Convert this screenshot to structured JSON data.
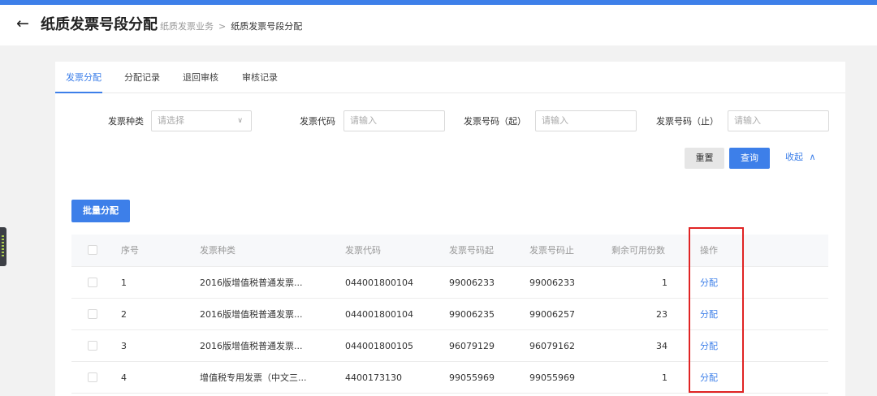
{
  "header": {
    "title": "纸质发票号段分配",
    "breadcrumb": [
      "纸质发票业务",
      "纸质发票号段分配"
    ],
    "breadcrumb_sep": ">"
  },
  "tabs": [
    {
      "label": "发票分配",
      "active": true
    },
    {
      "label": "分配记录",
      "active": false
    },
    {
      "label": "退回审核",
      "active": false
    },
    {
      "label": "审核记录",
      "active": false
    }
  ],
  "filters": {
    "type_label": "发票种类",
    "type_placeholder": "请选择",
    "code_label": "发票代码",
    "code_placeholder": "请输入",
    "start_label": "发票号码（起）",
    "start_placeholder": "请输入",
    "end_label": "发票号码（止）",
    "end_placeholder": "请输入"
  },
  "actions": {
    "reset": "重置",
    "query": "查询",
    "collapse": "收起",
    "batch": "批量分配"
  },
  "table": {
    "columns": [
      "序号",
      "发票种类",
      "发票代码",
      "发票号码起",
      "发票号码止",
      "剩余可用份数",
      "操作"
    ],
    "rows": [
      {
        "index": "1",
        "type": "2016版增值税普通发票...",
        "code": "044001800104",
        "start": "99006233",
        "end": "99006233",
        "remaining": "1",
        "op": "分配"
      },
      {
        "index": "2",
        "type": "2016版增值税普通发票...",
        "code": "044001800104",
        "start": "99006235",
        "end": "99006257",
        "remaining": "23",
        "op": "分配"
      },
      {
        "index": "3",
        "type": "2016版增值税普通发票...",
        "code": "044001800105",
        "start": "96079129",
        "end": "96079162",
        "remaining": "34",
        "op": "分配"
      },
      {
        "index": "4",
        "type": "增值税专用发票（中文三...",
        "code": "4400173130",
        "start": "99055969",
        "end": "99055969",
        "remaining": "1",
        "op": "分配"
      }
    ]
  },
  "colors": {
    "primary": "#3d7fe9",
    "highlight": "#e02424"
  },
  "icons": {
    "back": "arrow-left-icon",
    "select": "chevron-down-icon",
    "collapse": "chevron-up-icon"
  }
}
